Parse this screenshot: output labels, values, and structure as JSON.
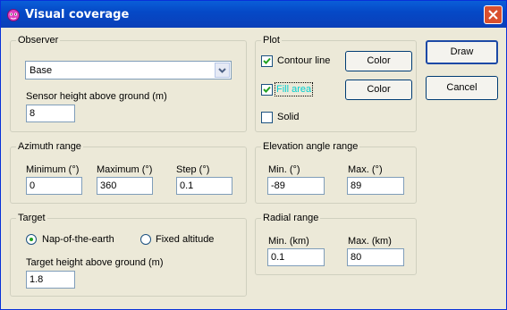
{
  "window": {
    "title": "Visual coverage"
  },
  "observer": {
    "label": "Observer",
    "selected": "Base",
    "sensor_label": "Sensor height above ground (m)",
    "sensor_value": "8"
  },
  "azimuth": {
    "label": "Azimuth range",
    "min_label": "Minimum (°)",
    "min_value": "0",
    "max_label": "Maximum (°)",
    "max_value": "360",
    "step_label": "Step (°)",
    "step_value": "0.1"
  },
  "target": {
    "label": "Target",
    "nap_label": "Nap-of-the-earth",
    "fixed_label": "Fixed altitude",
    "height_label": "Target height above ground (m)",
    "height_value": "1.8"
  },
  "plot": {
    "label": "Plot",
    "contour_label": "Contour line",
    "fill_label": "Fill area",
    "solid_label": "Solid",
    "color_label": "Color",
    "contour_checked": true,
    "fill_checked": true,
    "solid_checked": false
  },
  "elevation": {
    "label": "Elevation angle range",
    "min_label": "Min. (°)",
    "min_value": "-89",
    "max_label": "Max. (°)",
    "max_value": "89"
  },
  "radial": {
    "label": "Radial range",
    "min_label": "Min. (km)",
    "min_value": "0.1",
    "max_label": "Max. (km)",
    "max_value": "80"
  },
  "buttons": {
    "draw": "Draw",
    "cancel": "Cancel"
  },
  "colors": {
    "titlebar": "#0a5fd8",
    "fill_area_text": "#00d0d0",
    "window_bg": "#ece9d8"
  },
  "icons": {
    "app": "globe-app-icon",
    "close": "close-icon"
  }
}
